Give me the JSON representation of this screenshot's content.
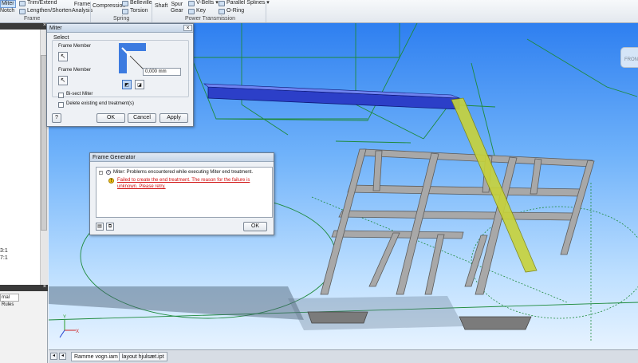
{
  "ribbon": {
    "miter_label": "Miter",
    "notch_label": "Notch",
    "trim_extend_label": "Trim/Extend",
    "lengthen_shorten_label": "Lengthen/Shorten",
    "frame_analysis_line1": "Frame",
    "frame_analysis_line2": "Analysis",
    "compression_label": "Compression",
    "belleville_label": "Belleville",
    "torsion_label": "Torsion",
    "shaft_label": "Shaft",
    "spur_gear_line1": "Spur",
    "spur_gear_line2": "Gear",
    "vbelts_label": "V-Belts",
    "key_label": "Key",
    "parallel_splines_label": "Parallel Splines",
    "oring_label": "O-Ring",
    "group_frame": "Frame",
    "group_spring": "Spring",
    "group_power_transmission": "Power Transmission"
  },
  "left_panel": {
    "values": [
      "3:1",
      "7:1"
    ],
    "tab_label": "rnal Rules"
  },
  "miter_dialog": {
    "title": "Miter",
    "select_label": "Select",
    "frame_member_1": "Frame Member",
    "frame_member_2": "Frame Member",
    "offset_value": "0,000 mm",
    "bisect_label": "Bi-sect Miter",
    "delete_existing_label": "Delete existing end treatment(s)",
    "ok": "OK",
    "cancel": "Cancel",
    "apply": "Apply",
    "help": "?"
  },
  "frame_generator_dialog": {
    "title": "Frame Generator",
    "msg_main": "Miter: Problems encountered while executing Miter end treatment.",
    "msg_error_1": "Failed to create the end treatment. The reason for the failure is",
    "msg_error_2": "unknown.  Please retry.",
    "ok": "OK"
  },
  "viewcube": {
    "label": "FRON"
  },
  "tabs": [
    {
      "label": "Ramme vogn.iam",
      "active": true
    },
    {
      "label": "layout hjulsæt.ipt",
      "active": false
    }
  ],
  "colors": {
    "selected_member": "#2c3fc8",
    "highlight_member": "#c8d33a",
    "sketch_lines": "#1e8a3c",
    "frame_gray": "#9a9a9a",
    "error_text": "#d01010"
  }
}
